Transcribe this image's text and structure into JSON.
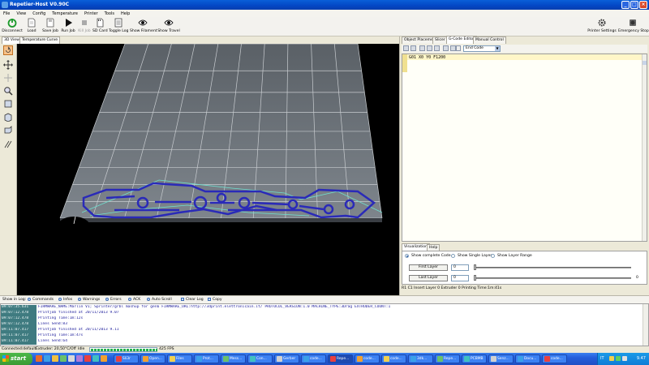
{
  "window": {
    "title": "Repetier-Host V0.90C"
  },
  "menu": [
    "File",
    "View",
    "Config",
    "Temperature",
    "Printer",
    "Tools",
    "Help"
  ],
  "toolbar": {
    "disconnect": "Disconnect",
    "load": "Load",
    "save_job": "Save Job",
    "run_job": "Run Job",
    "kill_job": "Kill Job",
    "sd_card": "SD Card",
    "toggle_log": "Toggle Log",
    "show_filament": "Show Filament",
    "show_travel": "Show Travel",
    "printer_settings": "Printer Settings",
    "emergency_stop": "Emergency Stop"
  },
  "left_tabs": [
    "3D View",
    "Temperature Curve"
  ],
  "right_tabs": [
    "Object Placement",
    "Slicer",
    "G-Code Editor",
    "Manual Control"
  ],
  "gcode": {
    "select_value": "End Code",
    "line1": "G01 X0 Y0 F1200"
  },
  "visualization": {
    "tabs": [
      "Visualization",
      "Help"
    ],
    "show_complete": "Show complete Code",
    "show_single": "Show Single Layer",
    "show_range": "Show Layer Range",
    "first_layer_btn": "First Layer",
    "first_layer_val": "0",
    "last_layer_btn": "Last Layer",
    "last_layer_val": "0",
    "last_layer_max": "0"
  },
  "right_status": "R1  C1  Insert  Layer 0  Extruder 0  Printing Time:1m:41s",
  "log_toolbar": {
    "show_in_log": "Show in Log:",
    "commands": "Commands",
    "infos": "Infos",
    "warnings": "Warnings",
    "errors": "Errors",
    "ack": "ACK",
    "auto_scroll": "Auto Scroll",
    "clear_log": "Clear Log",
    "copy": "Copy"
  },
  "log": [
    {
      "ts": "09:07:35.631",
      "msg": "FIRMWARE_NAME:Marlin V1; Sprinter/grbl mashup for gen6 FIRMWARE_URL:http://3dprint.elettronicain.it/ PROTOCOL_VERSION:1.0 MACHINE_TYPE:3Drag EXTRUDER_COUNT:1"
    },
    {
      "ts": "09:07:12.478",
      "msg": "Printjob finished at 20/11/2013 9.07"
    },
    {
      "ts": "09:07:12.478",
      "msg": "Printing Time:1m:12s"
    },
    {
      "ts": "09:07:12.478",
      "msg": "Lines Send:83"
    },
    {
      "ts": "09:11:07.417",
      "msg": "Printjob finished at 20/11/2013 9.11"
    },
    {
      "ts": "09:11:07.417",
      "msg": "Printing Time:1m:47s"
    },
    {
      "ts": "09:11:07.417",
      "msg": "Lines Send:64"
    }
  ],
  "status": {
    "connection": "Connected:default",
    "extruder": "Extruder: 20,50°C/Off",
    "idle": "Idle",
    "progress": 1.0,
    "fps": "425 FPS"
  },
  "taskbar": {
    "start": "start",
    "tasks": [
      "Sli3r",
      "Open...",
      "Files",
      "Prot...",
      "Mess...",
      "Con...",
      "Gerber",
      "code...",
      "Repe...",
      "code...",
      "code...",
      "3dk...",
      "Repe...",
      "PCBMB",
      "Senz...",
      "Docu...",
      "code..."
    ],
    "active_task": 8,
    "clock": "9.47",
    "lang": "IT"
  },
  "colors": {
    "titlebar": "#0a5fd8",
    "log_timestamp_bg": "#3f7b80",
    "log_text": "#1a1a9a",
    "toolpath": "#2a2ab8",
    "travel": "#6fe0d0"
  }
}
